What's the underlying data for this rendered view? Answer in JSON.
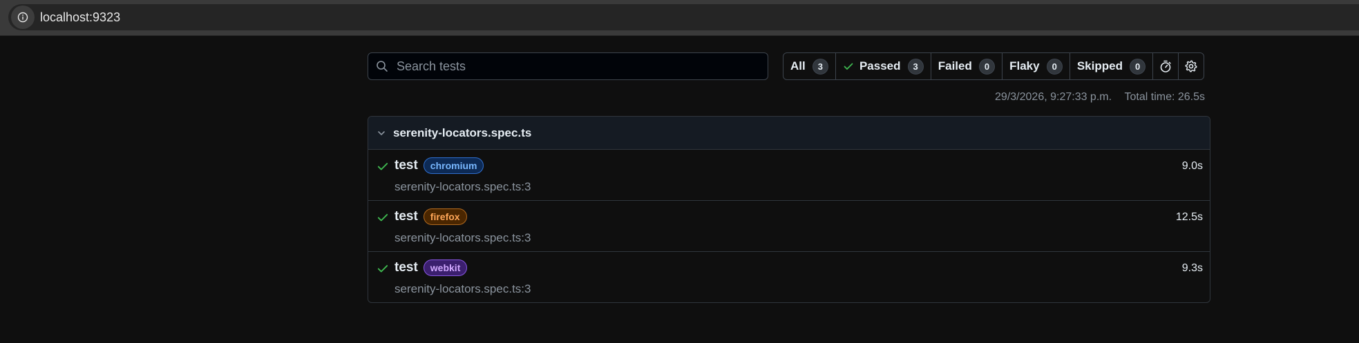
{
  "browser": {
    "url": "localhost:9323",
    "info_icon": "info-icon"
  },
  "search": {
    "placeholder": "Search tests",
    "value": ""
  },
  "filters": [
    {
      "label": "All",
      "count": "3"
    },
    {
      "label": "Passed",
      "count": "3",
      "icon": "check-icon"
    },
    {
      "label": "Failed",
      "count": "0"
    },
    {
      "label": "Flaky",
      "count": "0"
    },
    {
      "label": "Skipped",
      "count": "0"
    }
  ],
  "toolbar_icons": [
    "stopwatch-icon",
    "gear-icon"
  ],
  "meta": {
    "timestamp": "29/3/2026, 9:27:33 p.m.",
    "total_time": "Total time: 26.5s"
  },
  "file": {
    "name": "serenity-locators.spec.ts",
    "tests": [
      {
        "title": "test",
        "project": "chromium",
        "location": "serenity-locators.spec.ts:3",
        "duration": "9.0s",
        "status": "passed"
      },
      {
        "title": "test",
        "project": "firefox",
        "location": "serenity-locators.spec.ts:3",
        "duration": "12.5s",
        "status": "passed"
      },
      {
        "title": "test",
        "project": "webkit",
        "location": "serenity-locators.spec.ts:3",
        "duration": "9.3s",
        "status": "passed"
      }
    ]
  },
  "colors": {
    "background": "#0f0f0f",
    "passed": "#3fb950",
    "chromium": "#79b8ff",
    "firefox": "#ffa657",
    "webkit": "#d2a8ff"
  }
}
